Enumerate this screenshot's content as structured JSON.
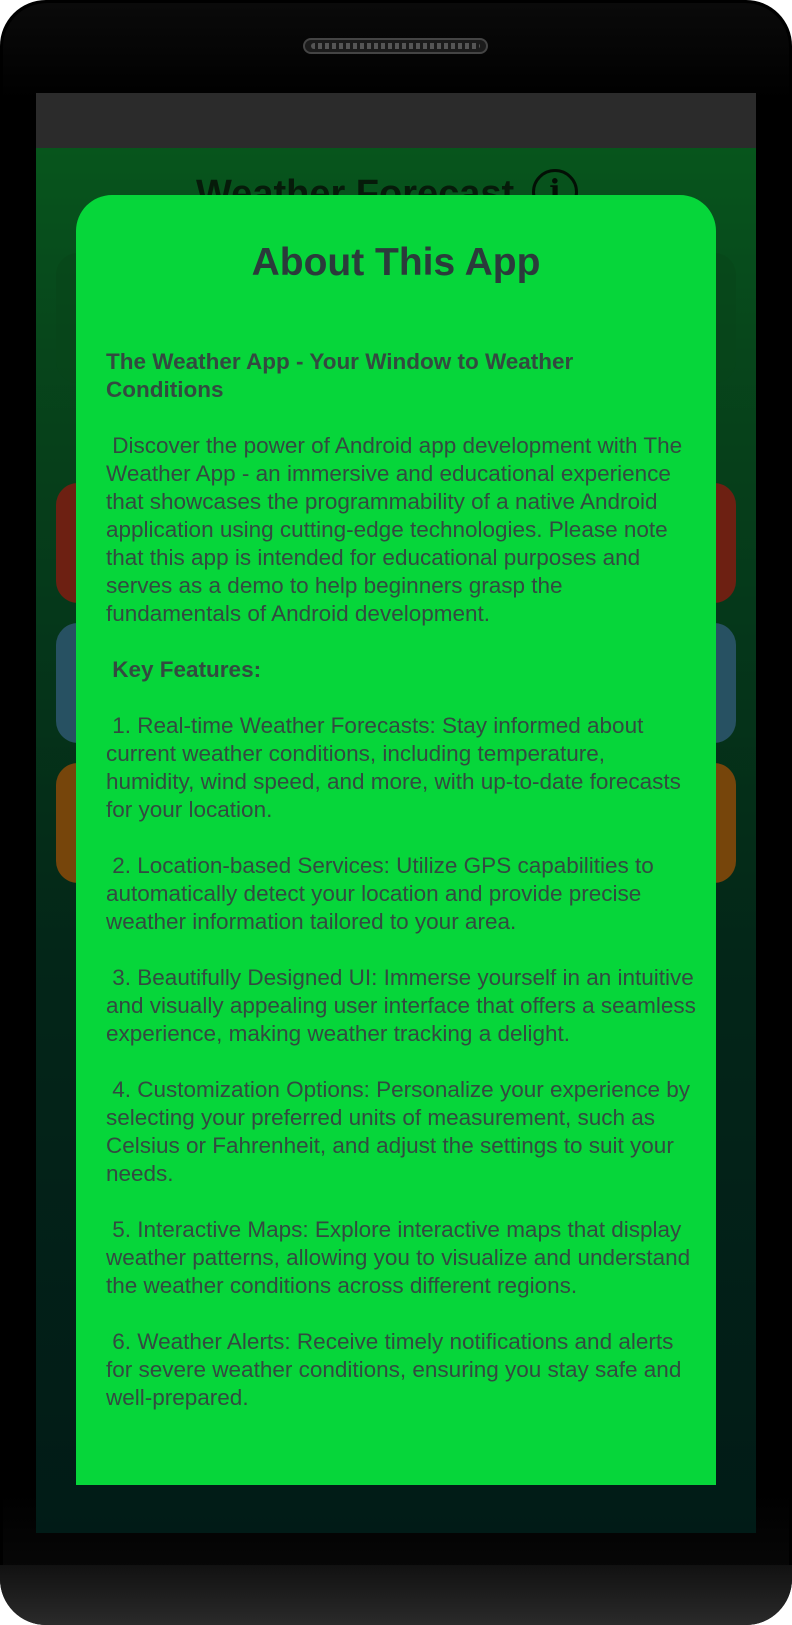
{
  "app": {
    "title": "Weather Forecast",
    "info_icon": "info-icon"
  },
  "dialog": {
    "title": "About This App",
    "heading": "The Weather App - Your Window to Weather Conditions",
    "intro": "Discover the power of Android app development with The Weather App - an immersive and educational experience that showcases the programmability of a native Android application using cutting-edge technologies. Please note that this app is intended for educational purposes and serves as a demo to help beginners grasp the fundamentals of Android development.",
    "features_heading": "Key Features:",
    "features": [
      "1. Real-time Weather Forecasts: Stay informed about current weather conditions, including temperature, humidity, wind speed, and more, with up-to-date forecasts for your location.",
      "2. Location-based Services: Utilize GPS capabilities to automatically detect your location and provide precise weather information tailored to your area.",
      "3. Beautifully Designed UI: Immerse yourself in an intuitive and visually appealing user interface that offers a seamless experience, making weather tracking a delight.",
      "4. Customization Options: Personalize your experience by selecting your preferred units of measurement, such as Celsius or Fahrenheit, and adjust the settings to suit your needs.",
      "5. Interactive Maps: Explore interactive maps that display weather patterns, allowing you to visualize and understand the weather conditions across different regions.",
      "6. Weather Alerts: Receive timely notifications and alerts for severe weather conditions, ensuring you stay safe and well-prepared."
    ]
  },
  "colors": {
    "dialog_bg": "#06d63a",
    "text": "#334a40",
    "title_text": "#2b3b3b"
  }
}
